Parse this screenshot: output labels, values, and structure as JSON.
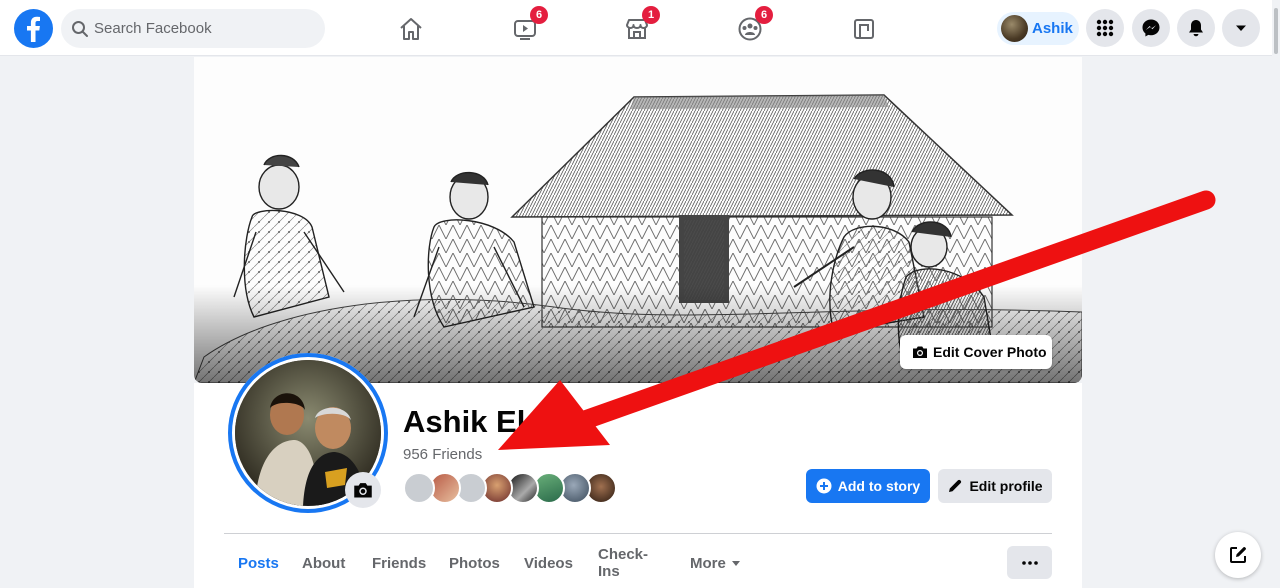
{
  "topbar": {
    "search_placeholder": "Search Facebook",
    "nav": [
      {
        "name": "home",
        "badge": ""
      },
      {
        "name": "watch",
        "badge": "6"
      },
      {
        "name": "marketplace",
        "badge": "1"
      },
      {
        "name": "groups",
        "badge": "6"
      },
      {
        "name": "gaming",
        "badge": ""
      }
    ],
    "profile_chip_label": "Ashik",
    "accent_color": "#1877f2",
    "badge_color": "#e41e3f"
  },
  "cover": {
    "edit_cover_label": "Edit Cover Photo"
  },
  "profile": {
    "name": "Ashik Elal",
    "friends_count": "956 Friends",
    "add_to_story_label": "Add to story",
    "edit_profile_label": "Edit profile",
    "friend_avatar_colors": [
      "#c9cdd2",
      "#b85a45",
      "#c9cdd2",
      "#8a3a3a",
      "#2a2a2a",
      "#3e8a5a",
      "#5a6a7a",
      "#4a3a2a"
    ]
  },
  "tabs": [
    {
      "label": "Posts",
      "active": true
    },
    {
      "label": "About",
      "active": false
    },
    {
      "label": "Friends",
      "active": false
    },
    {
      "label": "Photos",
      "active": false
    },
    {
      "label": "Videos",
      "active": false
    },
    {
      "label": "Check-Ins",
      "active": false
    },
    {
      "label": "More",
      "active": false
    }
  ],
  "annotation": {
    "arrow_color": "#ee1111"
  }
}
